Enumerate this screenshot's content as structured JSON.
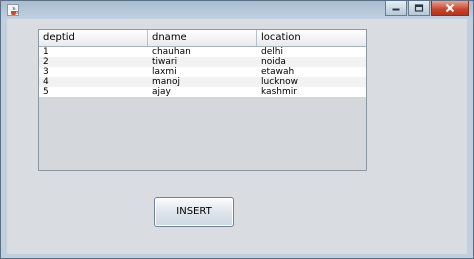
{
  "window": {
    "title": "",
    "buttons": {
      "minimize": "minimize-icon",
      "maximize": "maximize-icon",
      "close": "close-icon"
    }
  },
  "table": {
    "columns": [
      "deptid",
      "dname",
      "location"
    ],
    "rows": [
      [
        "1",
        "chauhan",
        "delhi"
      ],
      [
        "2",
        "tiwari",
        "noida"
      ],
      [
        "3",
        "laxmi",
        "etawah"
      ],
      [
        "4",
        "manoj",
        "lucknow"
      ],
      [
        "5",
        "ajay",
        "kashmir"
      ]
    ]
  },
  "actions": {
    "insert_label": "INSERT"
  },
  "colors": {
    "window_frame": "#c2cfdc",
    "client_bg": "#d9dde2",
    "close_button": "#c7452d",
    "row_alt": "#f2f2f2"
  }
}
